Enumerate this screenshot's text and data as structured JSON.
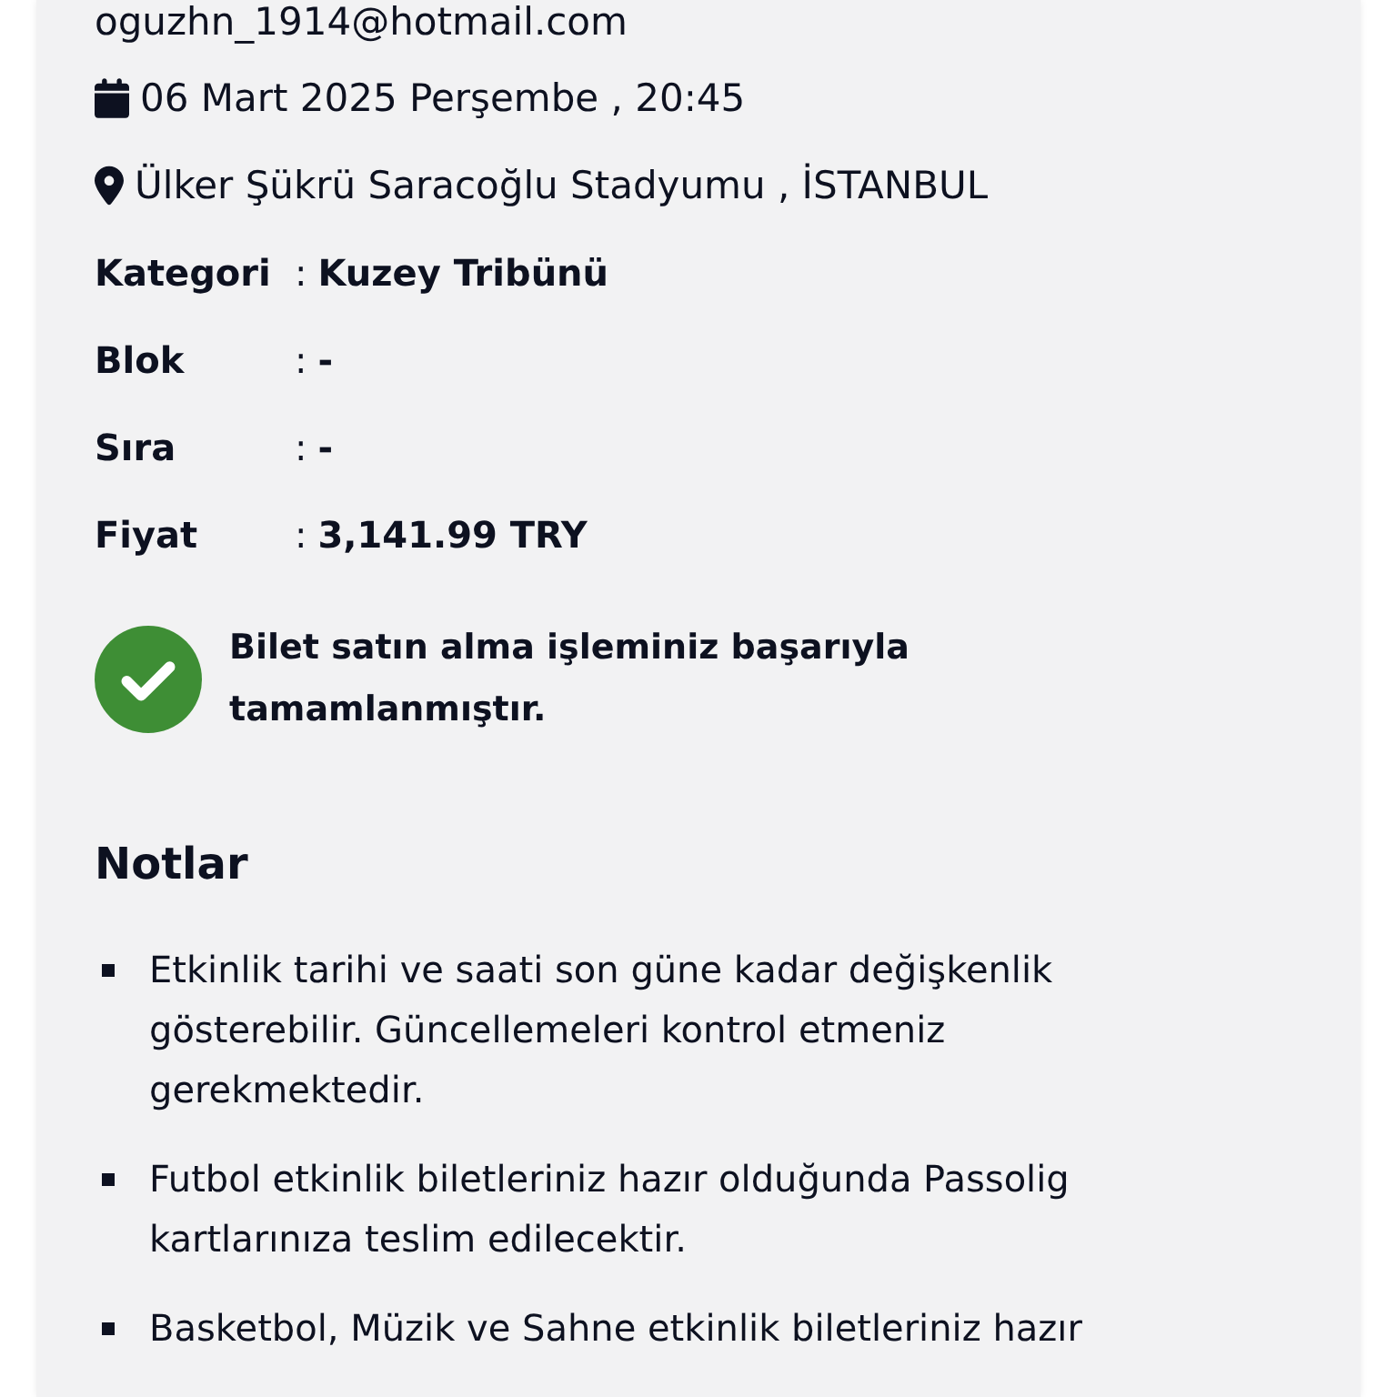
{
  "contact": {
    "email": "oguzhn_1914@hotmail.com"
  },
  "event": {
    "date": "06 Mart 2025 Perşembe , 20:45",
    "venue": "Ülker Şükrü Saracoğlu Stadyumu , İSTANBUL"
  },
  "details": [
    {
      "label": "Kategori",
      "separator": ":",
      "value": "Kuzey Tribünü"
    },
    {
      "label": "Blok",
      "separator": ":",
      "value": "-"
    },
    {
      "label": "Sıra",
      "separator": ":",
      "value": "-"
    },
    {
      "label": "Fiyat",
      "separator": ":",
      "value": "3,141.99 TRY"
    }
  ],
  "status": {
    "kind": "success",
    "message": "Bilet satın alma işleminiz başarıyla tamamlanmıştır."
  },
  "notes": {
    "title": "Notlar",
    "items": [
      "Etkinlik tarihi ve saati son güne kadar değişkenlik gösterebilir. Güncellemeleri kontrol etmeniz gerekmektedir.",
      "Futbol etkinlik biletleriniz hazır olduğunda Passolig kartlarınıza teslim edilecektir.",
      "Basketbol, Müzik ve Sahne etkinlik biletleriniz hazır"
    ]
  }
}
